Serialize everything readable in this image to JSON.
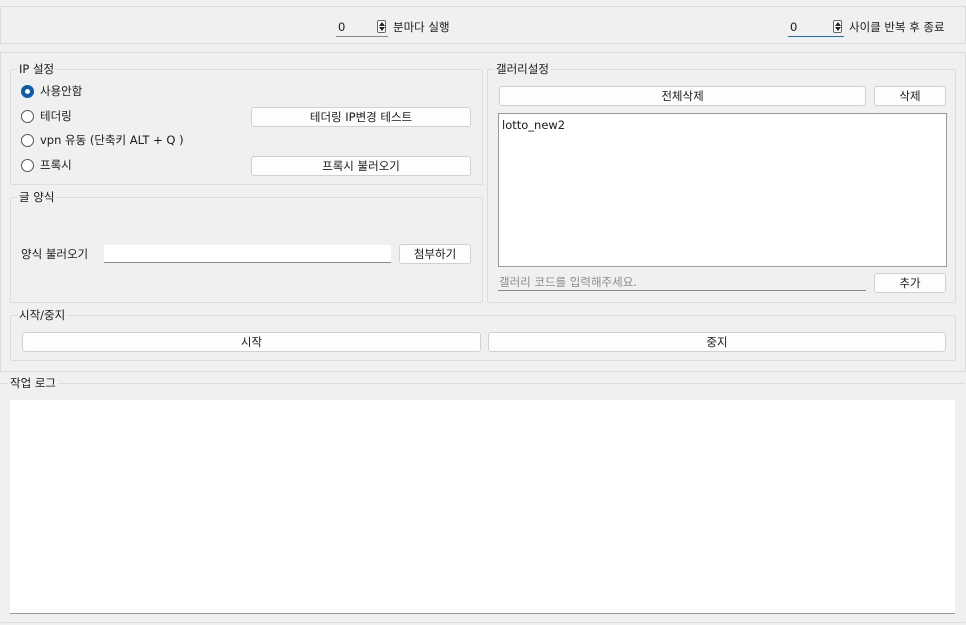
{
  "top_bar": {
    "interval": {
      "value": "0",
      "label": "분마다 실행"
    },
    "cycles": {
      "value": "0",
      "label": "사이클 반복 후 종료"
    }
  },
  "ip_settings": {
    "title": "IP 설정",
    "options": [
      {
        "label": "사용안함",
        "checked": true
      },
      {
        "label": "테더링",
        "checked": false
      },
      {
        "label": "vpn 유동 (단축키 ALT + Q )",
        "checked": false
      },
      {
        "label": "프록시",
        "checked": false
      }
    ],
    "tether_test_button": "테더링 IP변경 테스트",
    "proxy_load_button": "프록시 불러오기"
  },
  "post_format": {
    "title": "글 양식",
    "load_label": "양식 불러오기",
    "load_value": "",
    "attach_button": "첨부하기"
  },
  "gallery": {
    "title": "갤러리설정",
    "delete_all_button": "전체삭제",
    "delete_button": "삭제",
    "items": [
      "lotto_new2"
    ],
    "code_input_placeholder": "갤러리 코드를 입력해주세요.",
    "add_button": "추가"
  },
  "start_stop": {
    "title": "시작/중지",
    "start_button": "시작",
    "stop_button": "중지"
  },
  "log": {
    "title": "작업 로그",
    "content": ""
  }
}
